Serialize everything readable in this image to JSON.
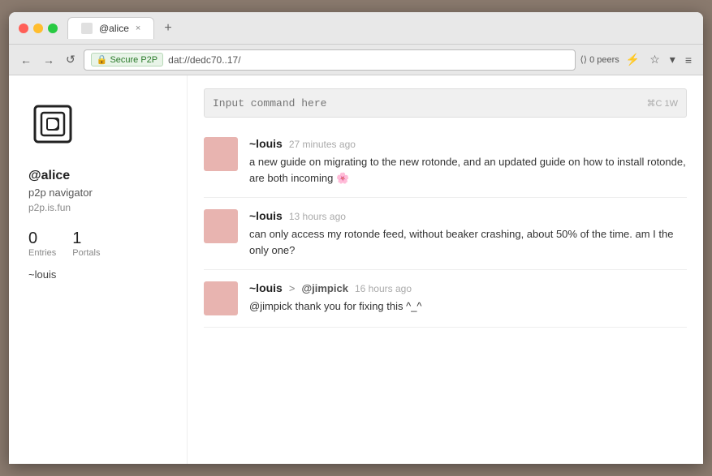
{
  "browser": {
    "traffic_lights": [
      "red",
      "yellow",
      "green"
    ],
    "tab": {
      "title": "@alice",
      "close_label": "×",
      "new_tab_label": "+"
    },
    "nav": {
      "back_label": "←",
      "forward_label": "→",
      "reload_label": "↺",
      "secure_label": "Secure P2P",
      "address": "dat://dedc70..17/",
      "peers_label": "0 peers",
      "lightning_label": "⚡",
      "star_label": "☆",
      "dropdown_label": "▾",
      "menu_label": "≡"
    }
  },
  "sidebar": {
    "username": "@alice",
    "tagline": "p2p navigator",
    "website": "p2p.is.fun",
    "stats": [
      {
        "num": "0",
        "label": "Entries"
      },
      {
        "num": "1",
        "label": "Portals"
      }
    ],
    "following_label": "~louis"
  },
  "feed": {
    "command_placeholder": "Input command here",
    "command_shortcuts": "⌘C 1W",
    "posts": [
      {
        "author": "~louis",
        "time": "27 minutes ago",
        "text": "a new guide on migrating to the new rotonde, and an updated guide on how to install rotonde, are both incoming 🌸"
      },
      {
        "author": "~louis",
        "time": "13 hours ago",
        "text": "can only access my rotonde feed, without beaker crashing, about 50% of the time. am I the only one?"
      },
      {
        "author": "~louis",
        "time": "16 hours ago",
        "mention": "@jimpick",
        "text": "@jimpick thank you for fixing this ^_^"
      }
    ]
  }
}
